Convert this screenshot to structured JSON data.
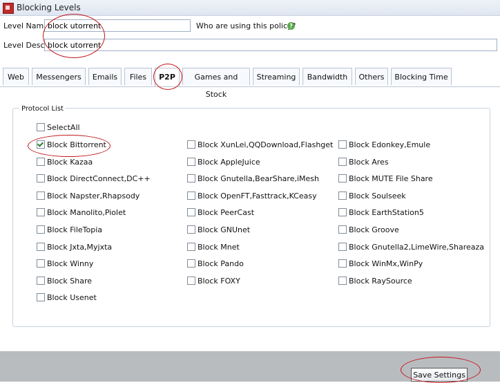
{
  "window": {
    "title": "Blocking Levels"
  },
  "form": {
    "level_name_label": "Level Name",
    "level_name_value": "block utorrent",
    "level_desc_label": "Level Desc",
    "level_desc_value": "block utorrent",
    "policy_question": "Who are using this policy?"
  },
  "tabs": [
    "Web",
    "Messengers",
    "Emails",
    "Files",
    "P2P",
    "Games and Stock",
    "Streaming",
    "Bandwidth",
    "Others",
    "Blocking Time"
  ],
  "active_tab": "P2P",
  "protocol_list": {
    "title": "Protocol List",
    "select_all": {
      "label": "SelectAll",
      "checked": false
    },
    "columns": [
      [
        {
          "label": "Block Bittorrent",
          "checked": true
        },
        {
          "label": "Block Kazaa",
          "checked": false
        },
        {
          "label": "Block DirectConnect,DC++",
          "checked": false
        },
        {
          "label": "Block Napster,Rhapsody",
          "checked": false
        },
        {
          "label": "Block Manolito,Piolet",
          "checked": false
        },
        {
          "label": "Block FileTopia",
          "checked": false
        },
        {
          "label": "Block Jxta,Myjxta",
          "checked": false
        },
        {
          "label": "Block Winny",
          "checked": false
        },
        {
          "label": "Block Share",
          "checked": false
        },
        {
          "label": "Block Usenet",
          "checked": false
        }
      ],
      [
        {
          "label": "Block XunLei,QQDownload,Flashget",
          "checked": false
        },
        {
          "label": "Block AppleJuice",
          "checked": false
        },
        {
          "label": "Block Gnutella,BearShare,iMesh",
          "checked": false
        },
        {
          "label": "Block OpenFT,Fasttrack,KCeasy",
          "checked": false
        },
        {
          "label": "Block PeerCast",
          "checked": false
        },
        {
          "label": "Block GNUnet",
          "checked": false
        },
        {
          "label": "Block Mnet",
          "checked": false
        },
        {
          "label": "Block Pando",
          "checked": false
        },
        {
          "label": "Block FOXY",
          "checked": false
        }
      ],
      [
        {
          "label": "Block Edonkey,Emule",
          "checked": false
        },
        {
          "label": "Block Ares",
          "checked": false
        },
        {
          "label": "Block MUTE File Share",
          "checked": false
        },
        {
          "label": "Block Soulseek",
          "checked": false
        },
        {
          "label": "Block EarthStation5",
          "checked": false
        },
        {
          "label": "Block Groove",
          "checked": false
        },
        {
          "label": "Block Gnutella2,LimeWire,Shareaza",
          "checked": false
        },
        {
          "label": "Block WinMx,WinPy",
          "checked": false
        },
        {
          "label": "Block RaySource",
          "checked": false
        }
      ]
    ]
  },
  "footer": {
    "save_label": "Save Settings"
  },
  "colors": {
    "annotation": "#c4161c",
    "footer_bg": "#b9bcbf",
    "accent": "#5aa84a"
  },
  "icons": {
    "app": "app-icon",
    "help": "help-icon",
    "check": "checkmark-icon"
  }
}
